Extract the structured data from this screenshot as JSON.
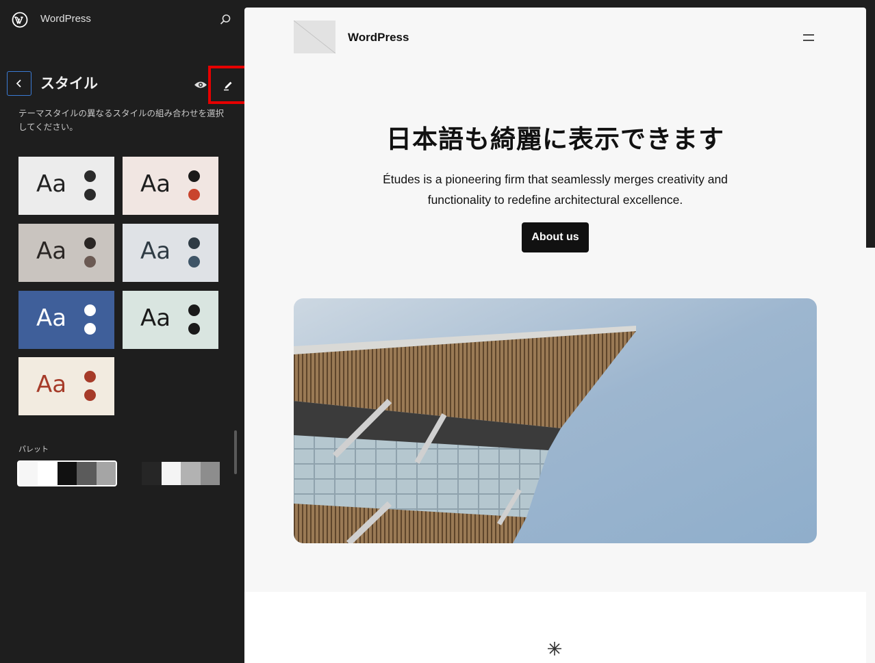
{
  "sidebar": {
    "site_name": "WordPress",
    "panel_title": "スタイル",
    "description": "テーマスタイルの異なるスタイルの組み合わせを選択してください。",
    "variations": [
      {
        "label": "Aa",
        "bg": "#ececec",
        "text": "#222222",
        "dot1": "#2b2b2b",
        "dot2": "#2b2b2b"
      },
      {
        "label": "Aa",
        "bg": "#f1e6e2",
        "text": "#1e1e1e",
        "dot1": "#1a1a1a",
        "dot2": "#c9442d"
      },
      {
        "label": "Aa",
        "bg": "#c9c4bf",
        "text": "#2a2624",
        "dot1": "#2a2624",
        "dot2": "#6b5a53"
      },
      {
        "label": "Aa",
        "bg": "#dfe2e6",
        "text": "#2f3b44",
        "dot1": "#2f3b44",
        "dot2": "#3f5567"
      },
      {
        "label": "Aa",
        "bg": "#3f5f9a",
        "text": "#ffffff",
        "dot1": "#ffffff",
        "dot2": "#ffffff"
      },
      {
        "label": "Aa",
        "bg": "#d9e5e0",
        "text": "#1a1a1a",
        "dot1": "#1a1a1a",
        "dot2": "#1a1a1a"
      },
      {
        "label": "Aa",
        "bg": "#f2ebe0",
        "text": "#a63b29",
        "dot1": "#a63b29",
        "dot2": "#a63b29"
      }
    ],
    "palette_label": "パレット",
    "palettes": [
      {
        "colors": [
          "#f6f6f6",
          "#ffffff",
          "#111111",
          "#5b5b5b",
          "#a5a5a5"
        ]
      },
      {
        "colors": [
          "#1e1e1e",
          "#262626",
          "#f4f4f4",
          "#b2b2b2",
          "#8d8d8d"
        ]
      }
    ]
  },
  "canvas": {
    "brand": "WordPress",
    "hero_title": "日本語も綺麗に表示できます",
    "hero_text": "Études is a pioneering firm that seamlessly merges creativity and functionality to redefine architectural excellence.",
    "about_button": "About us"
  },
  "icons": {
    "logo": "wordpress-logo-icon",
    "search": "search-icon",
    "back": "chevron-left-icon",
    "preview": "eye-icon",
    "edit": "pencil-icon",
    "menu": "hamburger-icon",
    "separator": "asterisk-icon"
  },
  "colors": {
    "sidebar_bg": "#1e1e1e",
    "focus_blue": "#3a7bd5",
    "highlight_red": "#e60000",
    "canvas_bg": "#f7f7f7"
  }
}
